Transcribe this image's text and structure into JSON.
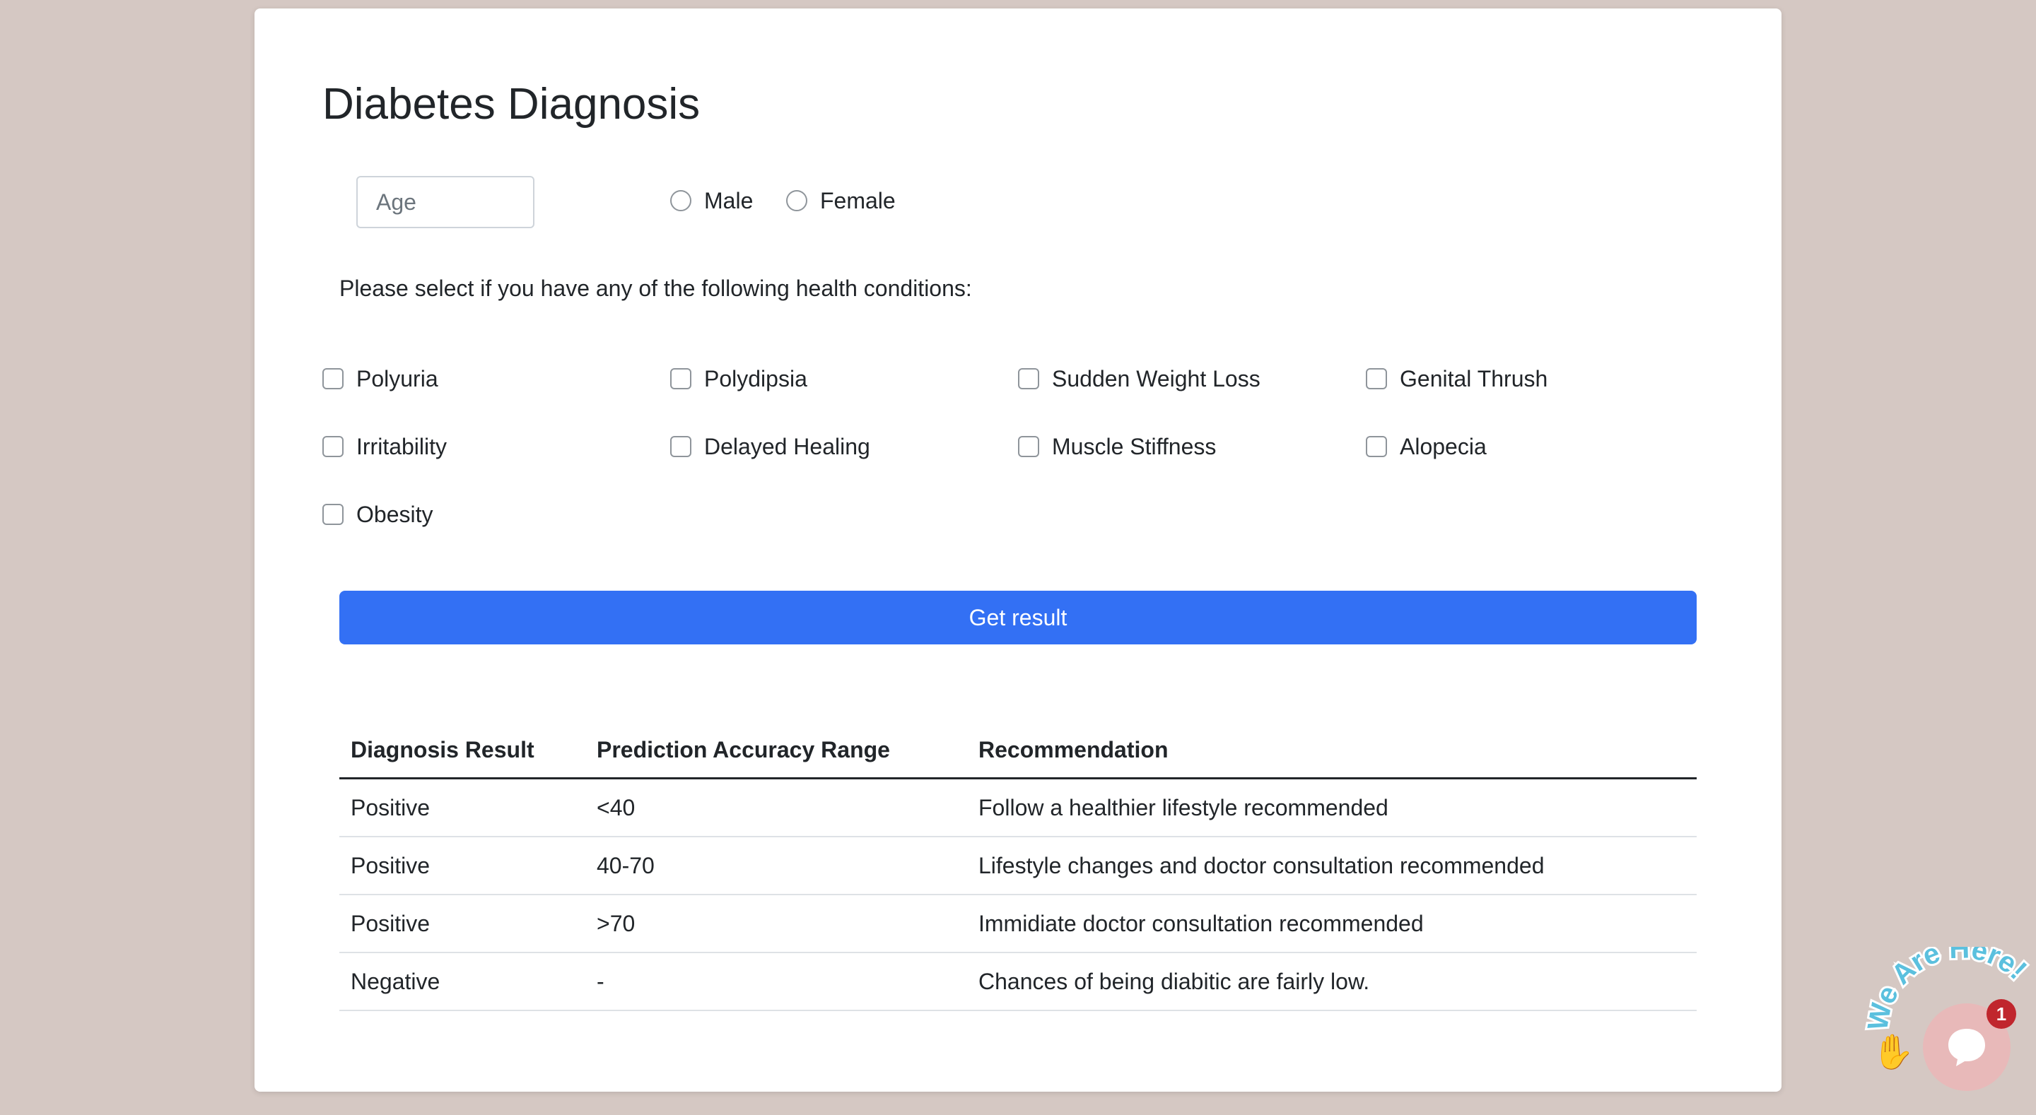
{
  "form": {
    "title": "Diabetes Diagnosis",
    "age_placeholder": "Age",
    "gender_options": [
      "Male",
      "Female"
    ],
    "conditions_prompt": "Please select if you have any of the following health conditions:",
    "conditions": [
      "Polyuria",
      "Polydipsia",
      "Sudden Weight Loss",
      "Genital Thrush",
      "Irritability",
      "Delayed Healing",
      "Muscle Stiffness",
      "Alopecia",
      "Obesity"
    ],
    "submit_label": "Get result"
  },
  "results_table": {
    "headers": [
      "Diagnosis Result",
      "Prediction Accuracy Range",
      "Recommendation"
    ],
    "rows": [
      [
        "Positive",
        "<40",
        "Follow a healthier lifestyle recommended"
      ],
      [
        "Positive",
        "40-70",
        "Lifestyle changes and doctor consultation recommended"
      ],
      [
        "Positive",
        ">70",
        "Immidiate doctor consultation recommended"
      ],
      [
        "Negative",
        "-",
        "Chances of being diabitic are fairly low."
      ]
    ]
  },
  "chat_widget": {
    "banner_text": "We Are Here!",
    "unread_count": "1",
    "hand_icon": "waving-hand-icon",
    "bubble_icon": "chat-bubble-icon",
    "colors": {
      "bubble": "#e8b9b9",
      "badge": "#c0262d",
      "banner_text": "#5bc0de"
    }
  },
  "colors": {
    "page_background": "#d5c8c3",
    "primary_button": "#3370f4"
  }
}
